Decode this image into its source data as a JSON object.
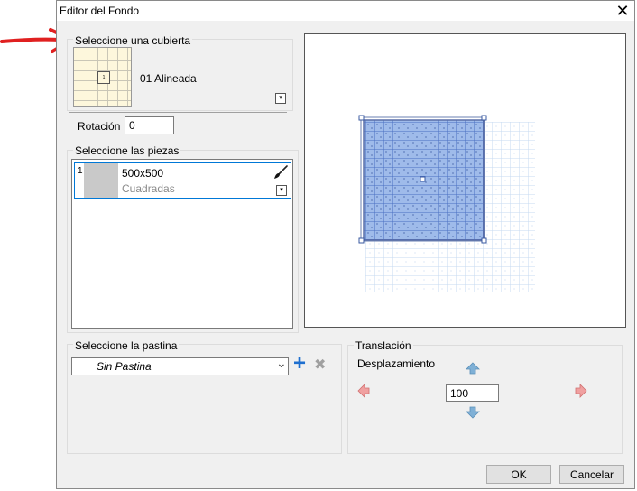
{
  "window": {
    "title": "Editor del Fondo",
    "close_symbol": "✕"
  },
  "cover": {
    "group_label": "Seleccione una cubierta",
    "name": "01 Alineada",
    "thumb_number": "1",
    "dropdown_symbol": "▾",
    "rotation_label": "Rotación",
    "rotation_value": "0"
  },
  "pieces": {
    "group_label": "Seleccione las piezas",
    "items": [
      {
        "index": "1",
        "size": "500x500",
        "type": "Cuadradas",
        "thumb_color": "#c9c9c9"
      }
    ],
    "dropdown_symbol": "▾"
  },
  "grout": {
    "group_label": "Seleccione la pastina",
    "value": "Sin Pastina",
    "add_symbol": "+",
    "remove_symbol": "✖",
    "chevron_symbol": "⌄"
  },
  "translation": {
    "group_label": "Translación",
    "displacement_label": "Desplazamiento",
    "value": "100"
  },
  "buttons": {
    "ok": "OK",
    "cancel": "Cancelar"
  },
  "colors": {
    "arrow_red": "#e02020",
    "accent_blue": "#1e6fcf",
    "selection_fill": "#9fbbea",
    "grid_light": "#c6daf1"
  }
}
